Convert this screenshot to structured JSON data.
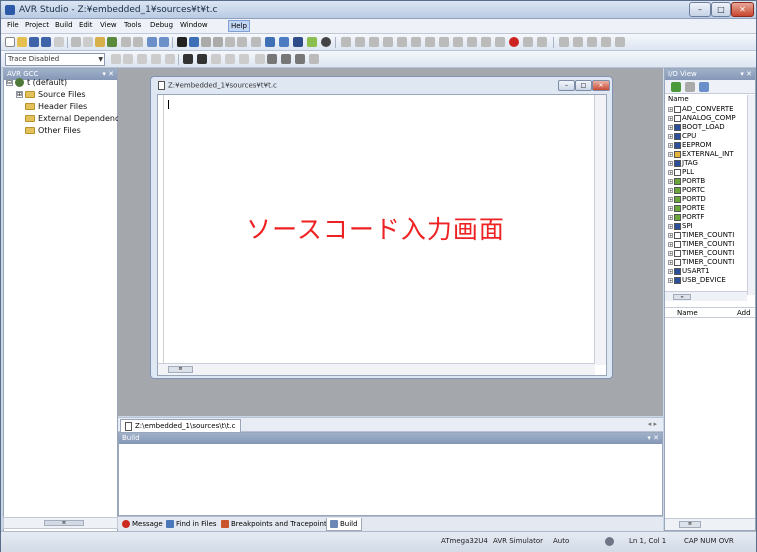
{
  "window": {
    "title": "AVR Studio - Z:¥embedded_1¥sources¥t¥t.c",
    "min": "–",
    "max": "□",
    "close": "✕"
  },
  "menu": [
    "File",
    "Project",
    "Build",
    "Edit",
    "View",
    "Tools",
    "Debug",
    "Window",
    "Help"
  ],
  "toolbar2": {
    "trace_select": "Trace Disabled"
  },
  "left_panel": {
    "header": "AVR GCC",
    "header_ctrls": "▾ ✕",
    "tree": [
      {
        "label": "t (default)",
        "level": 0,
        "kind": "project",
        "expander": "⊟"
      },
      {
        "label": "Source Files",
        "level": 1,
        "kind": "folder",
        "expander": "⊞"
      },
      {
        "label": "Header Files",
        "level": 1,
        "kind": "folder",
        "expander": ""
      },
      {
        "label": "External Dependenc",
        "level": 1,
        "kind": "folder",
        "expander": ""
      },
      {
        "label": "Other Files",
        "level": 1,
        "kind": "folder",
        "expander": ""
      }
    ],
    "hscroll_thumb": "≡"
  },
  "editor": {
    "title": "Z:¥embedded_1¥sources¥t¥t.c",
    "center_text": "ソースコード入力画面",
    "hscroll_thumb": "≡",
    "min": "–",
    "max": "□",
    "close": "✕"
  },
  "doc_tabs": {
    "active": "Z:\\embedded_1\\sources\\t\\t.c",
    "nav": "◂ ▸"
  },
  "build_panel": {
    "header": "Build",
    "header_ctrls": "▾ ✕"
  },
  "bottom_tabs": [
    {
      "label": "Message",
      "icon": "error-icon",
      "color": "#cc2a1f"
    },
    {
      "label": "Find in Files",
      "icon": "find-icon",
      "color": "#4a77b9"
    },
    {
      "label": "Breakpoints and Tracepoints",
      "icon": "breakpoint-icon",
      "color": "#c8562a"
    },
    {
      "label": "Build",
      "icon": "build-icon",
      "color": "#6d88b6"
    }
  ],
  "io_view": {
    "header": "I/O View",
    "header_ctrls": "▾ ✕",
    "column_name": "Name",
    "items": [
      "AD_CONVERTE",
      "ANALOG_COMP",
      "BOOT_LOAD",
      "CPU",
      "EEPROM",
      "EXTERNAL_INT",
      "JTAG",
      "PLL",
      "PORTB",
      "PORTC",
      "PORTD",
      "PORTE",
      "PORTF",
      "SPI",
      "TIMER_COUNTI",
      "TIMER_COUNTI",
      "TIMER_COUNTI",
      "TIMER_COUNTI",
      "USART1",
      "USB_DEVICE"
    ],
    "lower_col_name": "Name",
    "lower_col_addr": "Add",
    "hscroll_thumb": "≡",
    "bottom_scroll_thumb": "≡"
  },
  "status": {
    "device": "ATmega32U4",
    "platform": "AVR Simulator",
    "mode": "Auto",
    "position": "Ln 1, Col 1",
    "keys": "CAP  NUM  OVR"
  },
  "colors": {
    "annotation": "#ee2222",
    "accent": "#c3d6f3"
  }
}
